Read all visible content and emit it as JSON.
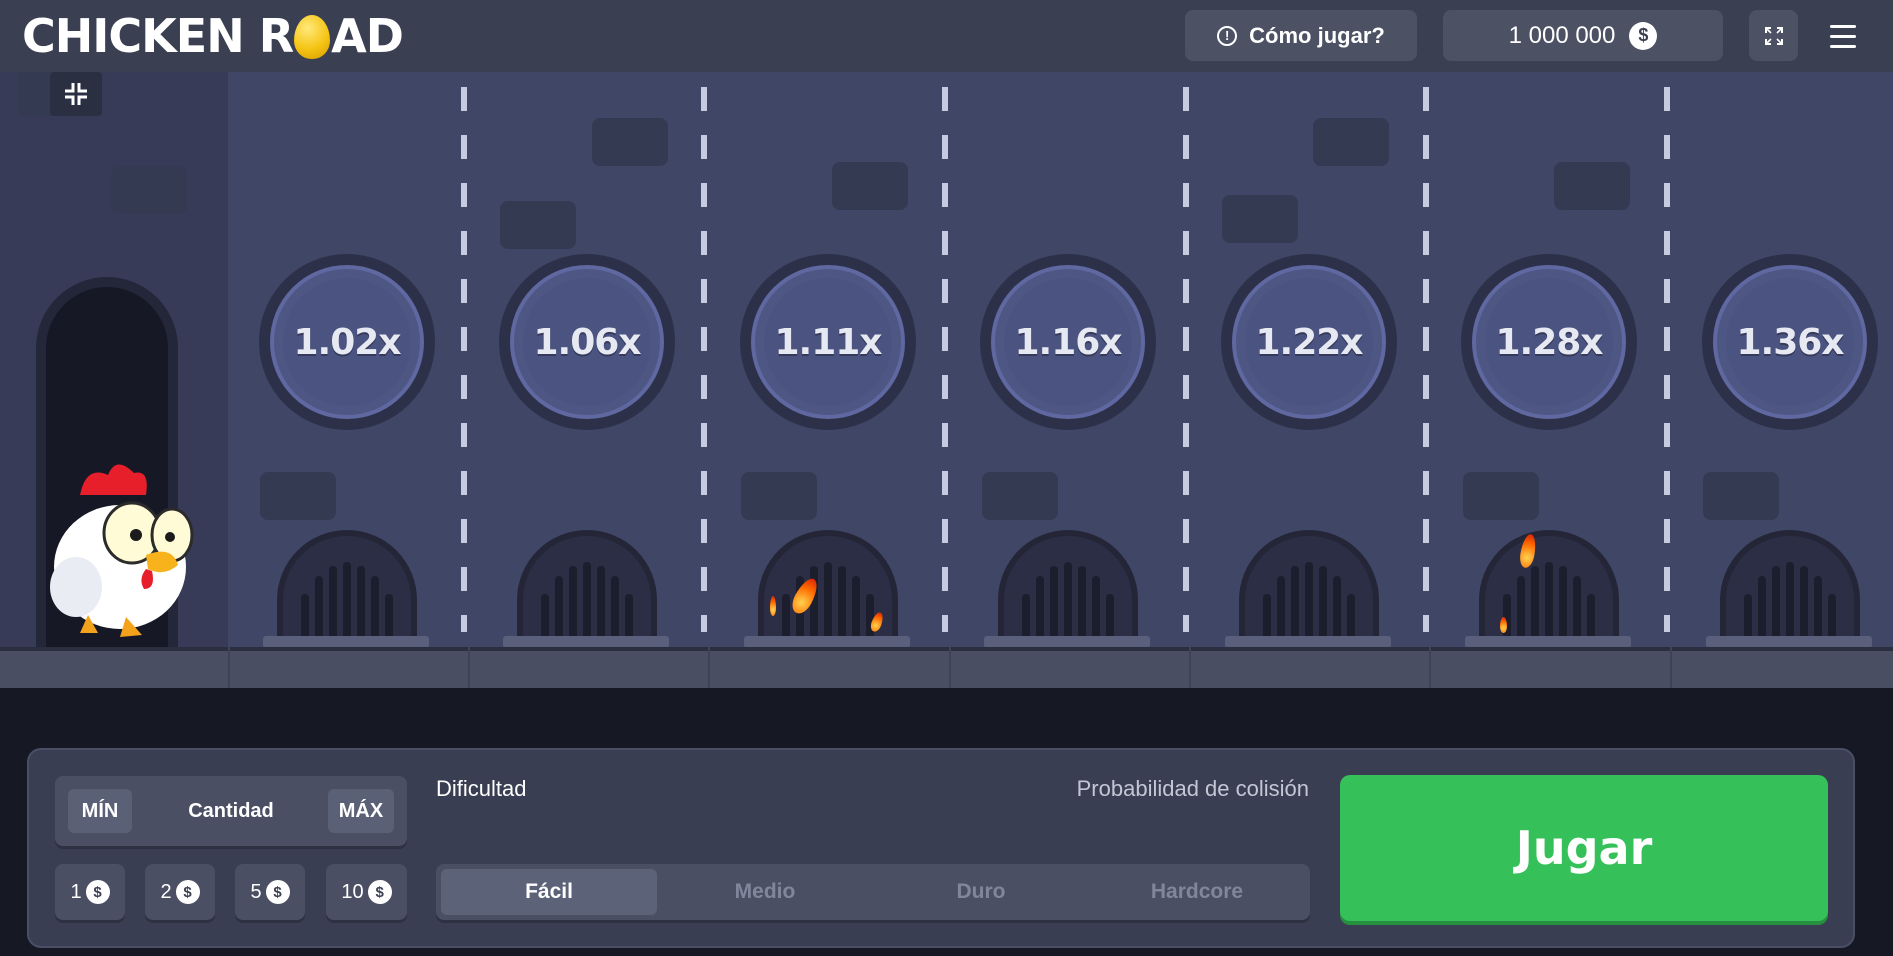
{
  "header": {
    "logo_left": "CHICKEN R",
    "logo_right": "AD",
    "how_to_play": "Cómo jugar?",
    "balance": "1 000 000",
    "currency_symbol": "$"
  },
  "icons": [
    "info-icon",
    "coin-icon",
    "fullscreen-icon",
    "menu-icon",
    "collapse-icon",
    "egg-icon",
    "chicken-icon",
    "fire-icon",
    "sewer-icon"
  ],
  "lanes": [
    {
      "multiplier": "1.02x",
      "fire": false
    },
    {
      "multiplier": "1.06x",
      "fire": false
    },
    {
      "multiplier": "1.11x",
      "fire": true
    },
    {
      "multiplier": "1.16x",
      "fire": false
    },
    {
      "multiplier": "1.22x",
      "fire": false
    },
    {
      "multiplier": "1.28x",
      "fire": true
    },
    {
      "multiplier": "1.36x",
      "fire": false
    }
  ],
  "controls": {
    "min_label": "MÍN",
    "amount_label": "Cantidad",
    "max_label": "MÁX",
    "quick_amounts": [
      "1",
      "2",
      "5",
      "10"
    ],
    "difficulty_label": "Dificultad",
    "collision_label": "Probabilidad de colisión",
    "difficulties": [
      "Fácil",
      "Medio",
      "Duro",
      "Hardcore"
    ],
    "selected_difficulty": "Fácil",
    "play_label": "Jugar"
  },
  "colors": {
    "play": "#35c05a",
    "header": "#3b3f52",
    "scene": "#3f4666",
    "panel": "#3a3e52"
  }
}
